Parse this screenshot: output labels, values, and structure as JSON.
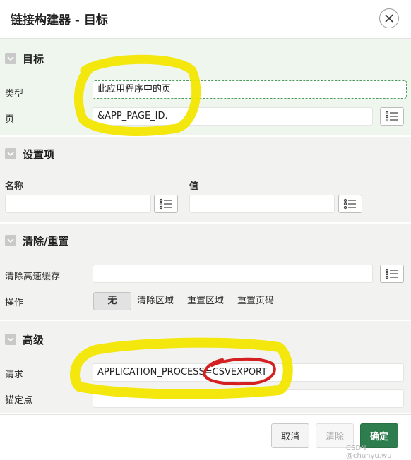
{
  "dialog": {
    "title": "链接构建器 - 目标",
    "close_icon": "close-icon"
  },
  "target": {
    "section_title": "目标",
    "type_label": "类型",
    "type_value": "此应用程序中的页",
    "page_label": "页",
    "page_value": "&APP_PAGE_ID."
  },
  "settings": {
    "section_title": "设置项",
    "name_header": "名称",
    "value_header": "值",
    "name_value": "",
    "value_value": ""
  },
  "clear_reset": {
    "section_title": "清除/重置",
    "clear_cache_label": "清除高速缓存",
    "clear_cache_value": "",
    "action_label": "操作",
    "actions": [
      "无",
      "清除区域",
      "重置区域",
      "重置页码"
    ],
    "selected_action": "无"
  },
  "advanced": {
    "section_title": "高级",
    "request_label": "请求",
    "request_value": "APPLICATION_PROCESS=CSVEXPORT",
    "anchor_label": "锚定点",
    "anchor_value": ""
  },
  "footer": {
    "cancel_label": "取消",
    "clear_label": "清除",
    "ok_label": "确定"
  },
  "colors": {
    "highlight": "#f2e600",
    "circle": "#d42020",
    "ok_button": "#2e7d4f",
    "active_section": "#eef6ee"
  },
  "watermark": "CSDN @chunyu.wu"
}
